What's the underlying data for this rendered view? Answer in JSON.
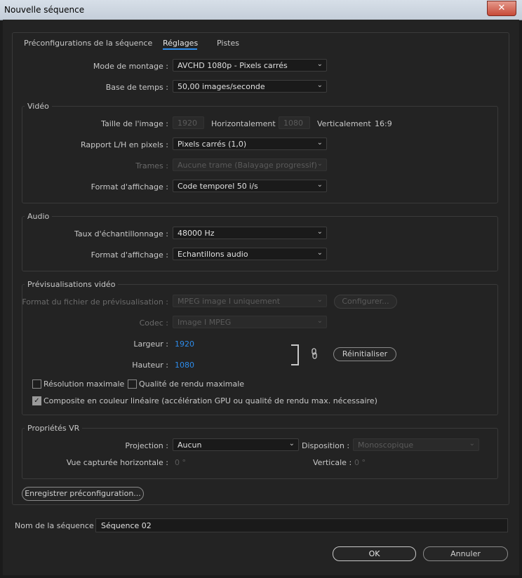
{
  "window": {
    "title": "Nouvelle séquence",
    "close_glyph": "✕"
  },
  "tabs": [
    {
      "label": "Préconfigurations de la séquence",
      "active": false
    },
    {
      "label": "Réglages",
      "active": true
    },
    {
      "label": "Pistes",
      "active": false
    }
  ],
  "general": {
    "editing_mode_label": "Mode de montage :",
    "editing_mode_value": "AVCHD 1080p - Pixels carrés",
    "timebase_label": "Base de temps :",
    "timebase_value": "50,00  images/seconde"
  },
  "video": {
    "group_title": "Vidéo",
    "frame_size_label": "Taille de l'image :",
    "width_value": "1920",
    "horizontal_label": "Horizontalement",
    "height_value": "1080",
    "vertical_label": "Verticalement",
    "aspect": "16:9",
    "pixel_aspect_label": "Rapport L/H en pixels :",
    "pixel_aspect_value": "Pixels carrés (1,0)",
    "fields_label": "Trames :",
    "fields_value": "Aucune trame (Balayage progressif)",
    "display_format_label": "Format d'affichage :",
    "display_format_value": "Code temporel 50 i/s"
  },
  "audio": {
    "group_title": "Audio",
    "sample_rate_label": "Taux d'échantillonnage :",
    "sample_rate_value": "48000 Hz",
    "display_format_label": "Format d'affichage :",
    "display_format_value": "Echantillons audio"
  },
  "preview": {
    "group_title": "Prévisualisations vidéo",
    "file_format_label": "Format du fichier de prévisualisation :",
    "file_format_value": "MPEG image I uniquement",
    "configure_label": "Configurer...",
    "codec_label": "Codec :",
    "codec_value": "Image I MPEG",
    "width_label": "Largeur :",
    "width_value": "1920",
    "height_label": "Hauteur :",
    "height_value": "1080",
    "reset_label": "Réinitialiser",
    "max_resolution_label": "Résolution maximale",
    "max_resolution_checked": false,
    "max_quality_label": "Qualité de rendu maximale",
    "max_quality_checked": false,
    "linear_composite_label": "Composite en couleur linéaire (accélération GPU ou qualité de rendu max. nécessaire)",
    "linear_composite_checked": true
  },
  "vr": {
    "group_title": "Propriétés VR",
    "projection_label": "Projection :",
    "projection_value": "Aucun",
    "layout_label": "Disposition :",
    "layout_value": "Monoscopique",
    "h_view_label": "Vue capturée horizontale :",
    "h_view_value": "0 °",
    "v_label": "Verticale :",
    "v_value": "0 °"
  },
  "save_preset_label": "Enregistrer préconfiguration...",
  "sequence_name_label": "Nom de la séquence :",
  "sequence_name_value": "Séquence 02",
  "ok_label": "OK",
  "cancel_label": "Annuler",
  "colors": {
    "accent": "#2d8ceb",
    "background": "#232323"
  }
}
